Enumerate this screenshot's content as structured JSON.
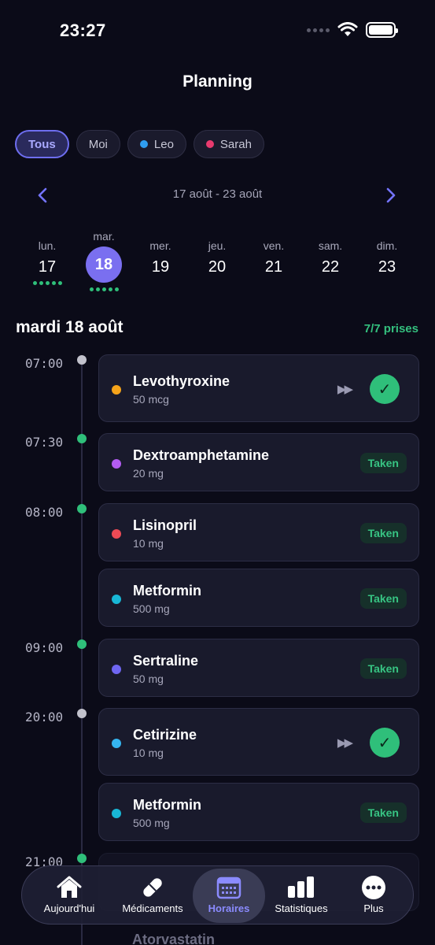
{
  "status": {
    "time": "23:27"
  },
  "header": {
    "title": "Planning"
  },
  "filters": [
    {
      "label": "Tous",
      "active": true
    },
    {
      "label": "Moi"
    },
    {
      "label": "Leo",
      "color": "#2f9df0"
    },
    {
      "label": "Sarah",
      "color": "#e83a6e"
    }
  ],
  "week": {
    "label": "17 août - 23 août"
  },
  "days": [
    {
      "name": "lun.",
      "num": "17",
      "dots": 5
    },
    {
      "name": "mar.",
      "num": "18",
      "dots": 5,
      "selected": true
    },
    {
      "name": "mer.",
      "num": "19"
    },
    {
      "name": "jeu.",
      "num": "20"
    },
    {
      "name": "ven.",
      "num": "21"
    },
    {
      "name": "sam.",
      "num": "22"
    },
    {
      "name": "dim.",
      "num": "23"
    }
  ],
  "schedule": {
    "date_heading": "mardi 18 août",
    "takes_count": "7/7 prises",
    "times": [
      "07:00",
      "07:30",
      "08:00",
      "09:00",
      "20:00",
      "21:00"
    ],
    "meds": [
      {
        "name": "Levothyroxine",
        "dose": "50 mcg",
        "color": "#f5a31a"
      },
      {
        "name": "Dextroamphetamine",
        "dose": "20 mg",
        "color": "#b35cf2",
        "status": "Taken"
      },
      {
        "name": "Lisinopril",
        "dose": "10 mg",
        "color": "#ec4a55",
        "status": "Taken"
      },
      {
        "name": "Metformin",
        "dose": "500 mg",
        "color": "#18b7d6",
        "status": "Taken"
      },
      {
        "name": "Sertraline",
        "dose": "50 mg",
        "color": "#6f66f2",
        "status": "Taken"
      },
      {
        "name": "Cetirizine",
        "dose": "10 mg",
        "color": "#35b5f0"
      },
      {
        "name": "Metformin",
        "dose": "500 mg",
        "color": "#18b7d6",
        "status": "Taken"
      },
      {
        "name": "Atorvastatin"
      }
    ]
  },
  "tabs": [
    {
      "label": "Aujourd'hui",
      "icon": "home-icon"
    },
    {
      "label": "Médicaments",
      "icon": "pill-icon"
    },
    {
      "label": "Horaires",
      "icon": "calendar-icon",
      "active": true
    },
    {
      "label": "Statistiques",
      "icon": "bar-chart-icon"
    },
    {
      "label": "Plus",
      "icon": "more-icon"
    }
  ],
  "colors": {
    "accent": "#7a6ff0",
    "success": "#2fbf7a",
    "background": "#0b0b18"
  }
}
